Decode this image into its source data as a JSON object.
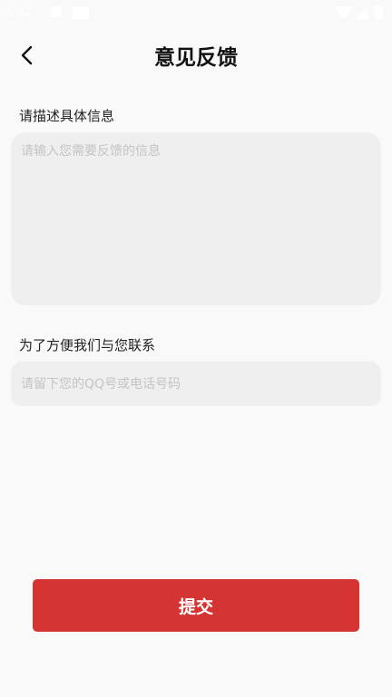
{
  "status_bar": {
    "time": "3:42",
    "icons": [
      "notification-icon",
      "image-icon",
      "wifi-icon",
      "signal-icon",
      "battery-icon"
    ]
  },
  "header": {
    "title": "意见反馈",
    "back_icon": "chevron-left-icon"
  },
  "form": {
    "description_label": "请描述具体信息",
    "description_placeholder": "请输入您需要反馈的信息",
    "contact_label": "为了方便我们与您联系",
    "contact_placeholder": "请留下您的QQ号或电话号码",
    "submit_label": "提交"
  },
  "colors": {
    "background": "#f9f9f9",
    "field_background": "#efefef",
    "accent": "#d43533"
  }
}
